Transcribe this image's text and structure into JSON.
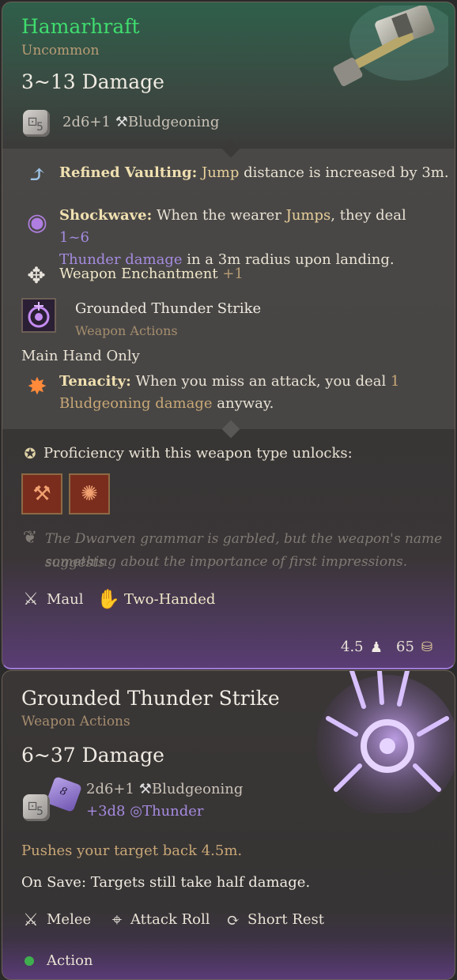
{
  "item": {
    "name": "Hamarhraft",
    "rarity": "Uncommon",
    "damage": "3~13 Damage",
    "dice": "2d6+1",
    "damage_type": "Bludgeoning",
    "passives": [
      {
        "name": "Refined Vaulting:",
        "pre": "",
        "link": "Jump",
        "post": " distance is increased by 3m."
      },
      {
        "name": "Shockwave:",
        "text1": "When the wearer ",
        "link": "Jumps",
        "text2": ", they deal ",
        "dmg": "1~6",
        "dmg_line2": "Thunder damage",
        "text3": " in a 3m radius upon landing."
      }
    ],
    "enchant_label": "Weapon Enchantment",
    "enchant_value": "+1",
    "action_name": "Grounded Thunder Strike",
    "action_type": "Weapon Actions",
    "main_hand": "Main Hand Only",
    "tenacity": {
      "name": "Tenacity:",
      "text1": "When you miss an attack, you deal ",
      "num": "1",
      "link": "Bludgeoning damage",
      "text2": " anyway."
    },
    "proficiency": "Proficiency with this weapon type unlocks:",
    "flavor1": "The Dwarven grammar is garbled, but the weapon's name suggests",
    "flavor2": "something about the importance of first impressions.",
    "weapon_type": "Maul",
    "handed": "Two-Handed",
    "weight": "4.5",
    "value": "65"
  },
  "action": {
    "name": "Grounded Thunder Strike",
    "type": "Weapon Actions",
    "damage": "6~37 Damage",
    "dice1": "2d6+1",
    "type1": "Bludgeoning",
    "dice2": "+3d8",
    "type2": "Thunder",
    "d8_label": "8",
    "pushes": "Pushes your target back 4.5m.",
    "on_save": "On Save: Targets still take half damage.",
    "tags": [
      "Melee",
      "Attack Roll",
      "Short Rest"
    ],
    "cost": "Action"
  },
  "colors": {
    "name_green": "#3fdc6e",
    "rarity_gold": "#b89c75",
    "link_gold": "#e7cf9a",
    "thunder_purple": "#a58be0",
    "action_dot": "#3fae4f"
  }
}
